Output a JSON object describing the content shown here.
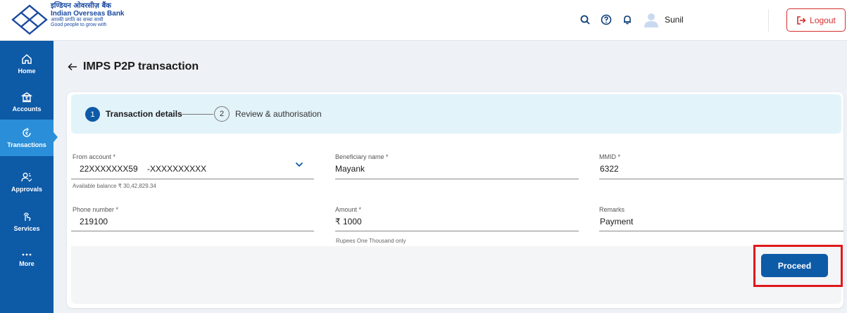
{
  "header": {
    "bank_hindi": "इण्डियन ओवरसीज़ बैंक",
    "bank_name": "Indian Overseas Bank",
    "tagline_hindi": "आपकी प्रगति का सच्चा साथी",
    "tagline": "Good people to grow with",
    "icons": [
      "search-icon",
      "help-icon",
      "bell-icon",
      "user-avatar-icon"
    ],
    "user_name": "Sunil",
    "logout_label": "Logout"
  },
  "sidebar": {
    "items": [
      {
        "label": "Home",
        "icon": "home-icon",
        "active": false
      },
      {
        "label": "Accounts",
        "icon": "bank-icon",
        "active": false
      },
      {
        "label": "Transactions",
        "icon": "transactions-icon",
        "active": true
      },
      {
        "label": "Approvals",
        "icon": "approvals-icon",
        "active": false
      },
      {
        "label": "Services",
        "icon": "services-icon",
        "active": false
      },
      {
        "label": "More",
        "icon": "more-icon",
        "active": false
      }
    ]
  },
  "page": {
    "title": "IMPS P2P transaction"
  },
  "stepper": {
    "step1_number": "1",
    "step1_label": "Transaction details",
    "step2_number": "2",
    "step2_label": "Review & authorisation"
  },
  "form": {
    "from_account_label": "From account *",
    "from_account_value": "22XXXXXXX59    -XXXXXXXXXX",
    "available_balance": "Available balance ₹ 30,42,829.34",
    "beneficiary_label": "Beneficiary name *",
    "beneficiary_value": "Mayank",
    "mmid_label": "MMID *",
    "mmid_value": "6322",
    "phone_label": "Phone number *",
    "phone_value": "219100",
    "amount_label": "Amount *",
    "amount_value": "₹ 1000",
    "amount_words": "Rupees One Thousand only",
    "remarks_label": "Remarks",
    "remarks_value": "Payment"
  },
  "actions": {
    "proceed_label": "Proceed"
  },
  "colors": {
    "primary": "#0d5aa7",
    "sidebar_active": "#2a8fd8",
    "logout": "#d32f2f",
    "highlight": "#e0191b",
    "stepper_bg": "#e3f3fa"
  }
}
